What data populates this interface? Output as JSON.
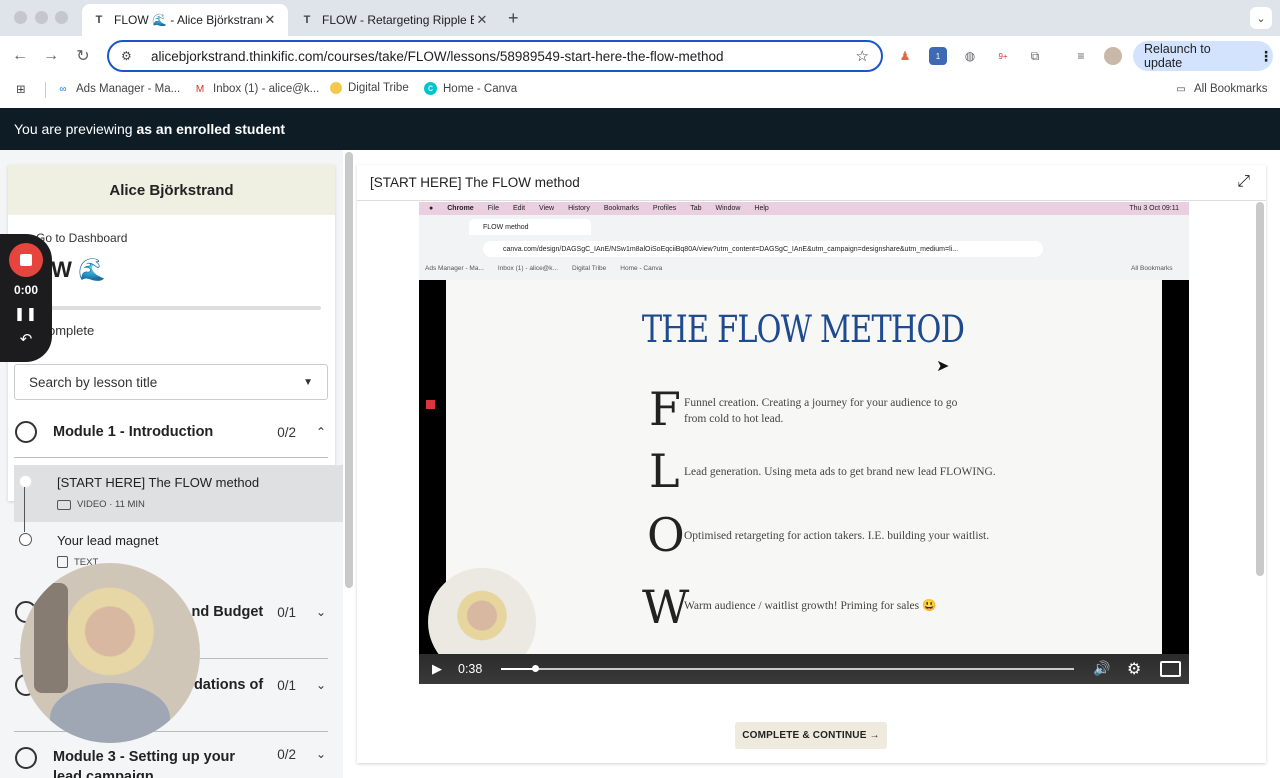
{
  "browser": {
    "tabs": [
      {
        "title": "FLOW 🌊 - Alice Björkstrand",
        "close": "✕",
        "active": true
      },
      {
        "title": "FLOW - Retargeting Ripple Ef",
        "close": "✕",
        "active": false
      }
    ],
    "new_tab": "+",
    "url": "alicebjorkstrand.thinkific.com/courses/take/FLOW/lessons/58989549-start-here-the-flow-method",
    "relaunch_label": "Relaunch to update",
    "bookmarks": [
      "Ads Manager - Ma...",
      "Inbox (1) - alice@k...",
      "Digital Tribe",
      "Home - Canva"
    ],
    "all_bookmarks": "All Bookmarks",
    "extension_badges": [
      "1",
      "9+"
    ]
  },
  "preview_bar": {
    "prefix": "You are previewing ",
    "emphasis": "as an enrolled student"
  },
  "sidebar": {
    "author": "Alice Björkstrand",
    "dashboard_link": "Go to Dashboard",
    "course_title": "OW 🌊",
    "complete_text": "omplete",
    "progress": 0.0,
    "search_placeholder": "Search by lesson title",
    "modules": [
      {
        "title": "Module 1 - Introduction",
        "count": "0/2",
        "chevron": "⌃"
      },
      {
        "title": "nd Budget",
        "count": "0/1",
        "chevron": "⌄"
      },
      {
        "title": "dations of",
        "count": "0/1",
        "chevron": "⌄"
      },
      {
        "title": "Module 3 - Setting up your",
        "title2": "lead campaign",
        "count": "0/2",
        "chevron": "⌄"
      }
    ],
    "lessons": [
      {
        "title": "[START HERE] The FLOW method",
        "meta": "VIDEO · 11 MIN"
      },
      {
        "title": "Your lead magnet",
        "meta": "TEXT"
      }
    ]
  },
  "recorder": {
    "time": "0:00"
  },
  "main": {
    "lesson_title": "[START HERE] The FLOW method",
    "complete_button": "COMPLETE & CONTINUE →"
  },
  "video": {
    "mac_menu": [
      "Chrome",
      "File",
      "Edit",
      "View",
      "History",
      "Bookmarks",
      "Profiles",
      "Tab",
      "Window",
      "Help"
    ],
    "mac_clock": "Thu 3 Oct 09:11",
    "inner_tab": "FLOW method",
    "inner_url": "canva.com/design/DAGSgC_IAnE/NSw1m8alOiSoEqciiBq80A/view?utm_content=DAGSgC_IAnE&utm_campaign=designshare&utm_medium=li...",
    "inner_bookmarks": [
      "Ads Manager - Ma...",
      "Inbox (1) - alice@k...",
      "Digital Tribe",
      "Home - Canva"
    ],
    "inner_all_bookmarks": "All Bookmarks",
    "slide_title": "THE FLOW METHOD",
    "flow": [
      {
        "letter": "F",
        "text": "Funnel creation. Creating a journey for your audience to go from cold to hot lead."
      },
      {
        "letter": "L",
        "text": "Lead generation. Using meta ads to get brand new lead FLOWING."
      },
      {
        "letter": "O",
        "text": "Optimised retargeting for action takers. I.E. building your waitlist."
      },
      {
        "letter": "W",
        "text": "Warm audience / waitlist growth!  Priming for sales 😃"
      }
    ],
    "time": "0:38",
    "progress": 0.06
  },
  "colors": {
    "accent": "#1a56c9",
    "preview_bar": "#0e1c26",
    "slide_title": "#1e4a8f",
    "record": "#e5453c"
  }
}
